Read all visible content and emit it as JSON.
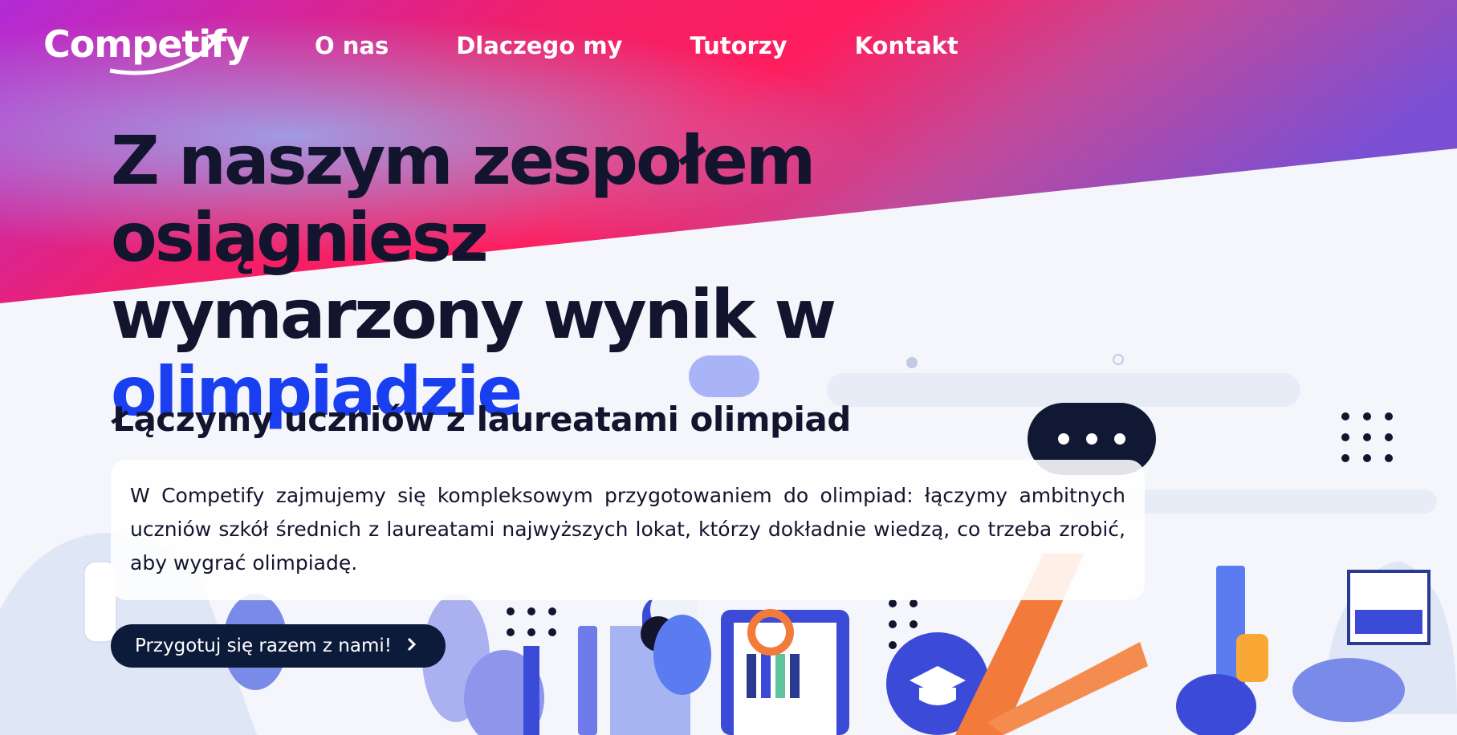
{
  "nav": {
    "logo_text": "Competify",
    "links": [
      {
        "label": "O nas"
      },
      {
        "label": "Dlaczego my"
      },
      {
        "label": "Tutorzy"
      },
      {
        "label": "Kontakt"
      }
    ]
  },
  "hero": {
    "headline_part1": "Z naszym zespołem osiągniesz wymarzony wynik w",
    "headline_accent": "olimpiadzie",
    "subheadline": "Łączymy uczniów z laureatami olimpiad",
    "description": "W Competify zajmujemy się kompleksowym przygotowaniem do olimpiad: łączymy ambitnych uczniów szkół średnich z laureatami najwyższych lokat, którzy dokładnie wiedzą, co trzeba zrobić, aby wygrać olimpiadę.",
    "cta_label": "Przygotuj się razem z nami!",
    "cta_icon": "chevron-right-icon"
  },
  "colors": {
    "headline": "#13152e",
    "accent": "#1a3ff0",
    "cta_bg": "#0d1b3a",
    "gradient_pink": "#ff1d5e",
    "gradient_purple": "#b12bd8"
  }
}
